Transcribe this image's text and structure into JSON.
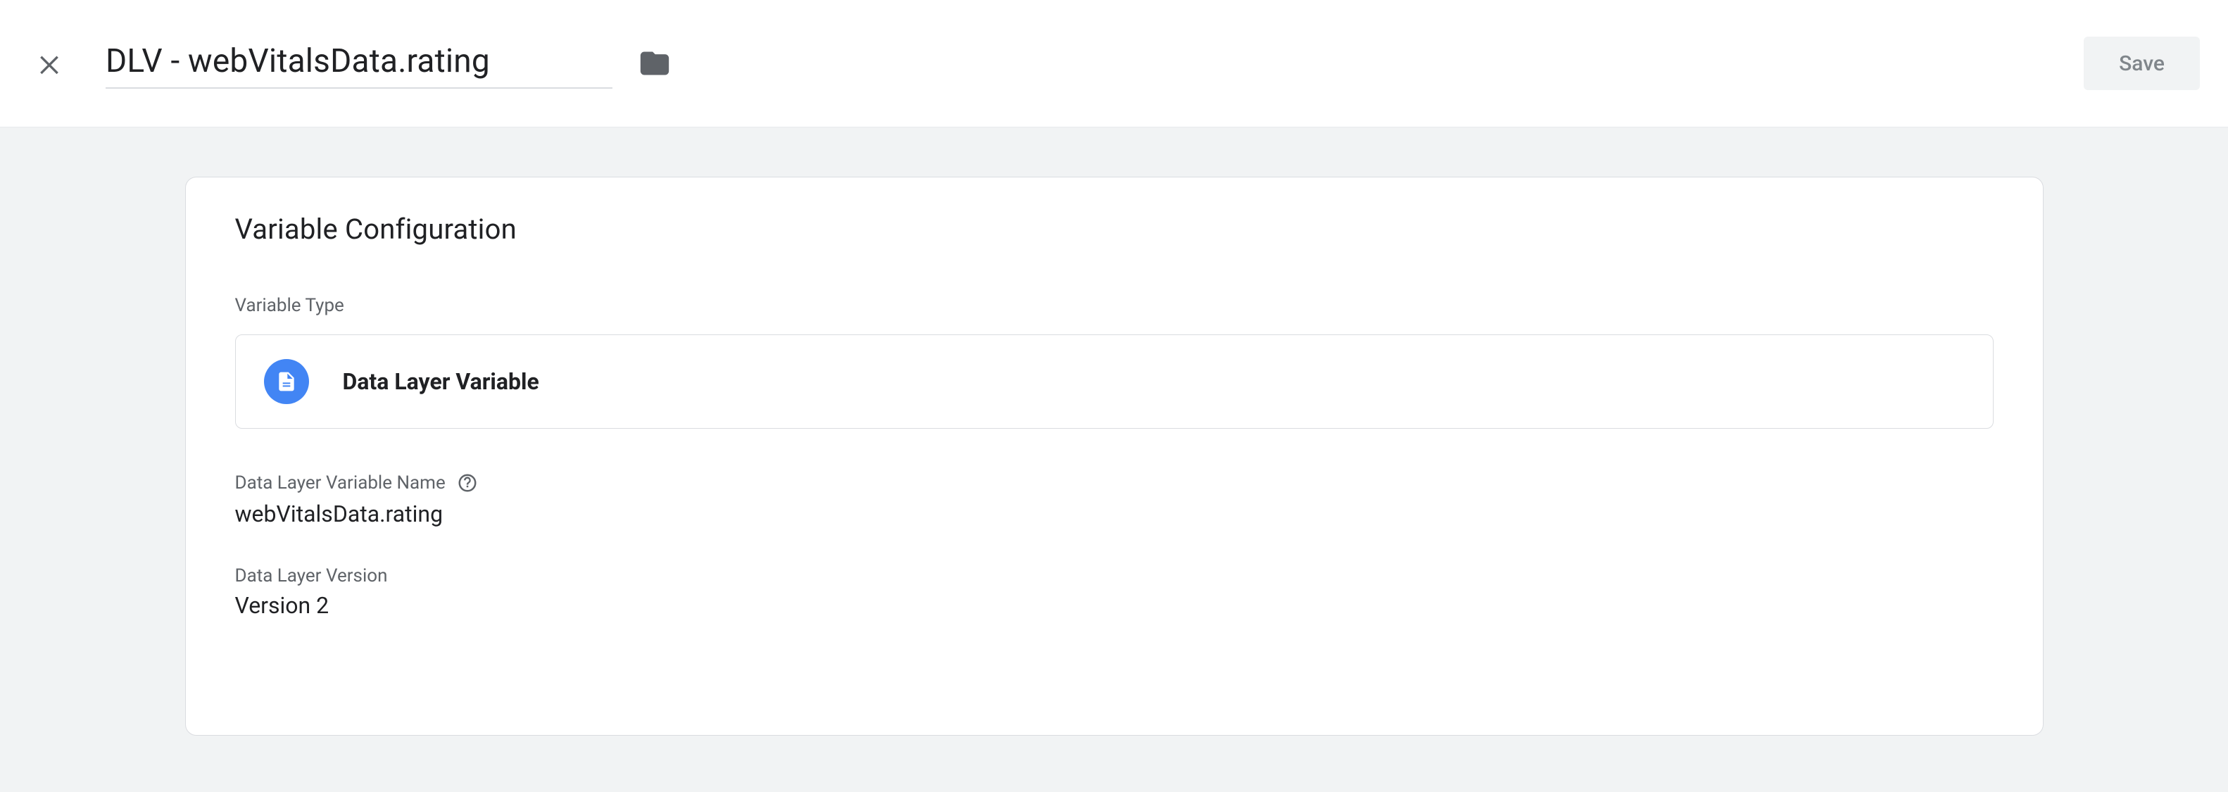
{
  "header": {
    "title": "DLV - webVitalsData.rating",
    "save_label": "Save"
  },
  "card": {
    "title": "Variable Configuration",
    "type_label": "Variable Type",
    "type_value": "Data Layer Variable",
    "name_label": "Data Layer Variable Name",
    "name_value": "webVitalsData.rating",
    "version_label": "Data Layer Version",
    "version_value": "Version 2"
  }
}
